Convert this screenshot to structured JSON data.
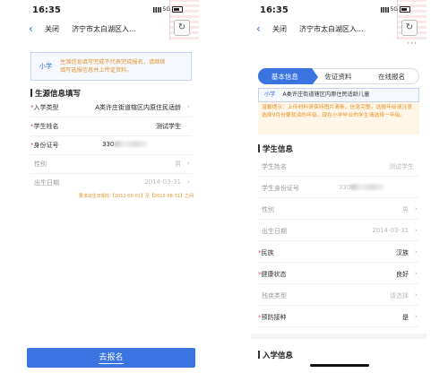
{
  "status": {
    "time": "16:35",
    "network": "5G"
  },
  "navbar": {
    "close": "关闭",
    "title": "济宁市太白湖区入...",
    "refresh_icon": "refresh-icon",
    "more": "···"
  },
  "left": {
    "notice": {
      "tag": "小学",
      "message": "生源信息填写完成不代表完成报名，请继续填写选报信息并上传证资料。"
    },
    "section_title": "生源信息填写",
    "fields": [
      {
        "label": "入学类型",
        "required": true,
        "value": "A类许庄街道辖区内原住民适龄",
        "chevron": true
      },
      {
        "label": "学生姓名",
        "required": true,
        "value": "测试学生",
        "chevron": false
      },
      {
        "label": "身份证号",
        "required": true,
        "value": "330",
        "chevron": false
      },
      {
        "label": "性别",
        "required": false,
        "value": "男",
        "chevron": true
      },
      {
        "label": "出生日期",
        "required": false,
        "value": "2014-03-31",
        "chevron": true
      }
    ],
    "birth_hint": "要求出生日期在【2012-09-01】至【2015-08-31】之间",
    "submit": "去报名"
  },
  "right": {
    "steps": [
      "基本信息",
      "佐证资料",
      "在线报名"
    ],
    "grade": {
      "tag": "小学",
      "text": "A类许庄街道辖区内原住民适龄儿童"
    },
    "warning": "温馨提示：上传材料请保持图片清晰，信息完整。选报年级请注意选择9月份要就读的年级。现在小学毕业的学生请选择一年级。",
    "section_title": "学生信息",
    "fields": [
      {
        "label": "学生姓名",
        "required": false,
        "value": "测试学生",
        "value_gray": true,
        "chevron": false
      },
      {
        "label": "学生身份证号",
        "required": false,
        "value": "330",
        "value_gray": true,
        "chevron": false
      },
      {
        "label": "性别",
        "required": false,
        "value": "男",
        "value_gray": true,
        "chevron": true
      },
      {
        "label": "出生日期",
        "required": false,
        "value": "2014-03-31",
        "value_gray": true,
        "chevron": true
      },
      {
        "label": "民族",
        "required": true,
        "value": "汉族",
        "value_gray": false,
        "chevron": true
      },
      {
        "label": "健康状态",
        "required": true,
        "value": "良好",
        "value_gray": false,
        "chevron": true
      },
      {
        "label": "残疾类型",
        "required": false,
        "value": "请选择",
        "value_gray": true,
        "chevron": true
      },
      {
        "label": "预防接种",
        "required": true,
        "value": "是",
        "value_gray": false,
        "chevron": true
      }
    ],
    "bottom_section_title": "入学信息"
  },
  "colors": {
    "primary": "#3a74e0",
    "warning": "#e6942c",
    "required": "#e35050"
  }
}
